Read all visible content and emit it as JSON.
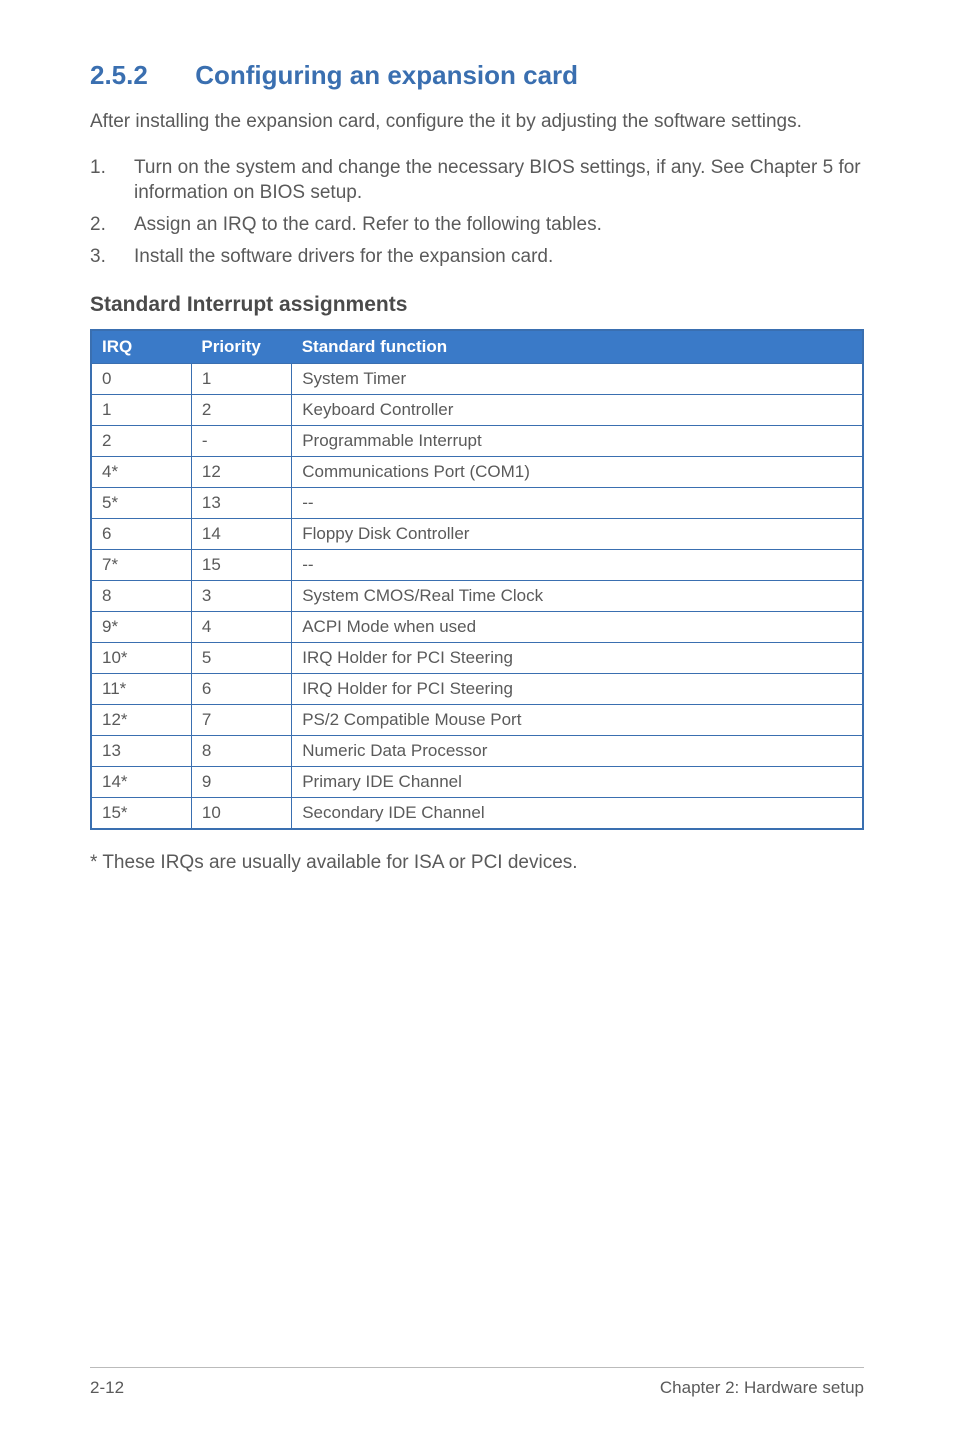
{
  "section": {
    "number": "2.5.2",
    "title": "Configuring an expansion card"
  },
  "intro": "After installing the expansion card, configure the it by adjusting the software settings.",
  "steps": [
    {
      "num": "1.",
      "text": "Turn on the system and change the necessary BIOS settings, if any. See Chapter 5 for information on BIOS setup."
    },
    {
      "num": "2.",
      "text": "Assign an IRQ to the card. Refer to the following tables."
    },
    {
      "num": "3.",
      "text": "Install the software drivers for the expansion card."
    }
  ],
  "subheading": "Standard Interrupt assignments",
  "table": {
    "headers": [
      "IRQ",
      "Priority",
      "Standard function"
    ],
    "rows": [
      {
        "irq": "0",
        "priority": "1",
        "func": "System Timer"
      },
      {
        "irq": "1",
        "priority": "2",
        "func": "Keyboard Controller"
      },
      {
        "irq": "2",
        "priority": "-",
        "func": "Programmable Interrupt"
      },
      {
        "irq": "4*",
        "priority": "12",
        "func": "Communications Port (COM1)"
      },
      {
        "irq": "5*",
        "priority": "13",
        "func": "--"
      },
      {
        "irq": "6",
        "priority": "14",
        "func": "Floppy Disk Controller"
      },
      {
        "irq": "7*",
        "priority": "15",
        "func": "--"
      },
      {
        "irq": "8",
        "priority": "3",
        "func": "System CMOS/Real Time Clock"
      },
      {
        "irq": "9*",
        "priority": "4",
        "func": "ACPI Mode when used"
      },
      {
        "irq": "10*",
        "priority": "5",
        "func": "IRQ Holder for PCI Steering"
      },
      {
        "irq": "11*",
        "priority": "6",
        "func": "IRQ Holder for PCI Steering"
      },
      {
        "irq": "12*",
        "priority": "7",
        "func": "PS/2 Compatible Mouse Port"
      },
      {
        "irq": "13",
        "priority": "8",
        "func": "Numeric Data Processor"
      },
      {
        "irq": "14*",
        "priority": "9",
        "func": "Primary IDE Channel"
      },
      {
        "irq": "15*",
        "priority": "10",
        "func": "Secondary IDE Channel"
      }
    ]
  },
  "footnote": "* These IRQs are usually available for ISA or PCI devices.",
  "footer": {
    "left": "2-12",
    "right": "Chapter 2:  Hardware setup"
  }
}
